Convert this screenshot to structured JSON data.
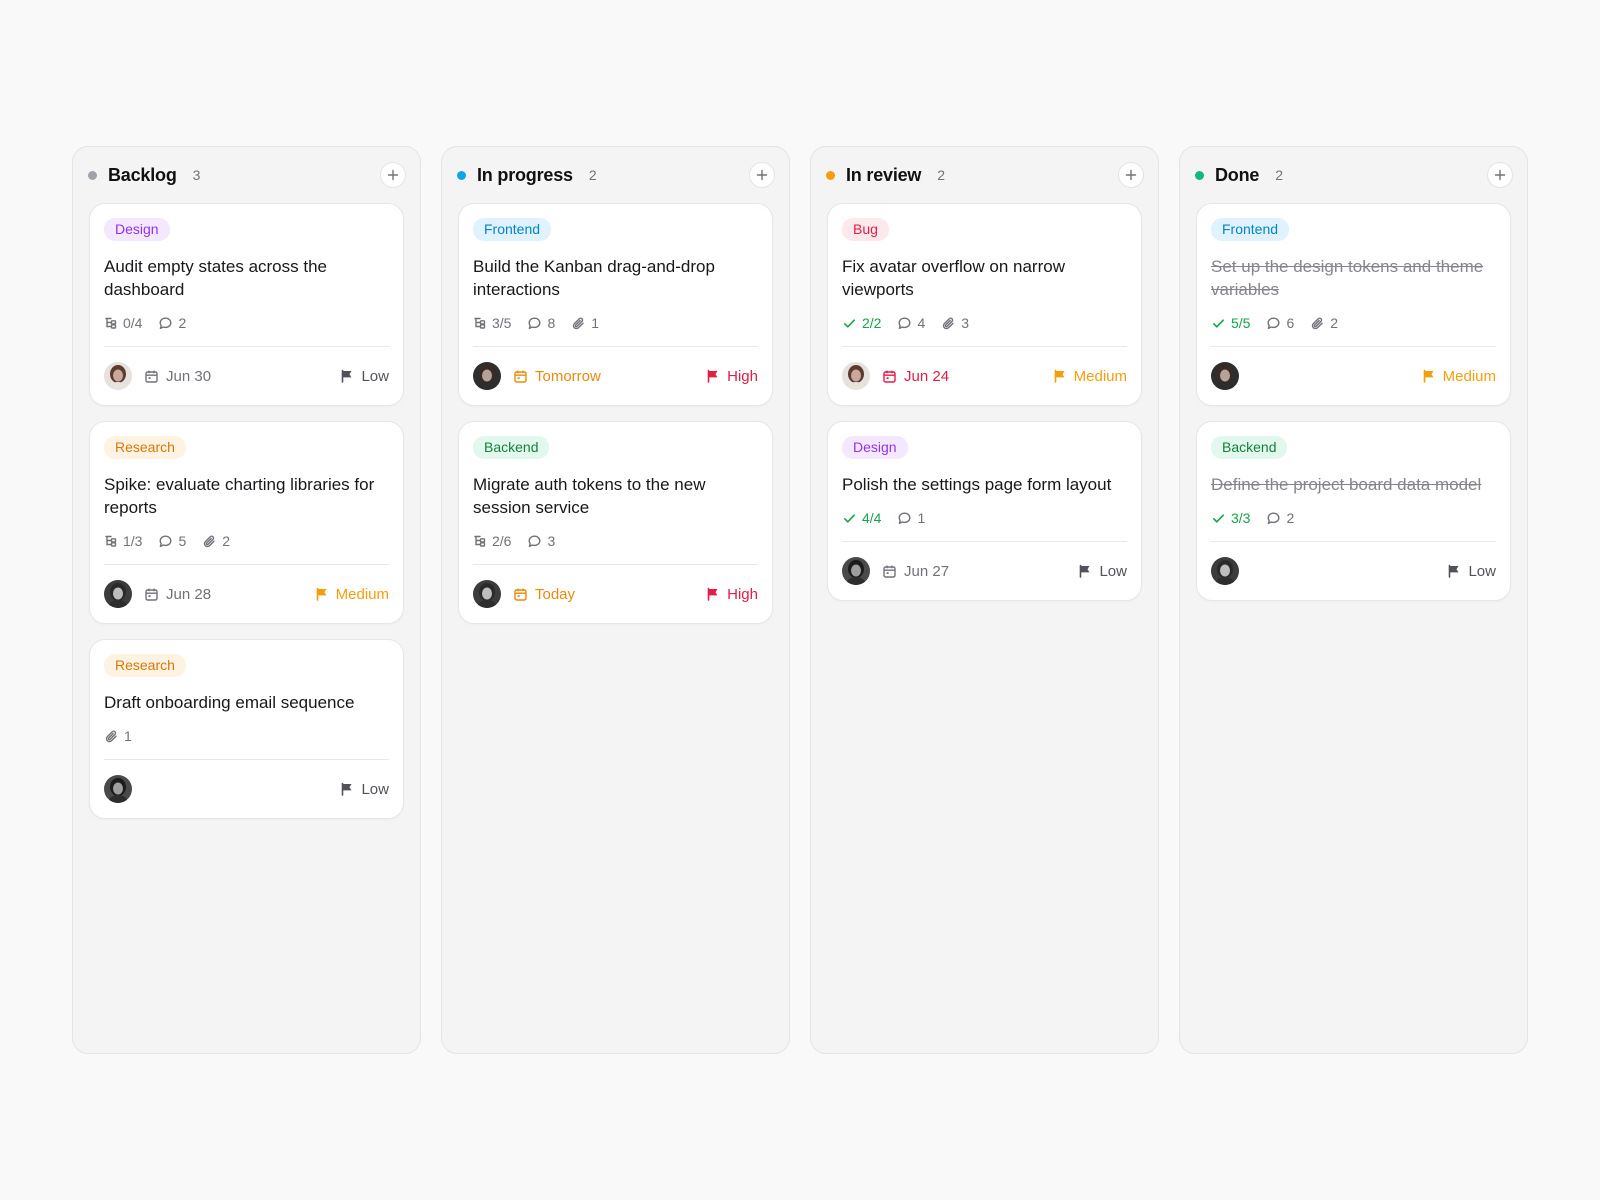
{
  "colors": {
    "backlog": "#a1a1aa",
    "in_progress": "#0ea5e9",
    "in_review": "#f59e0b",
    "done": "#10b981",
    "priority_low": "#52525b",
    "priority_medium": "#f59e0b",
    "priority_high": "#e11d48",
    "date_default": "#71717a",
    "date_soon": "#ea8a0c",
    "date_overdue": "#e11d48",
    "check_done": "#16a34a"
  },
  "tags": {
    "Design": {
      "bg": "#f3e8ff",
      "fg": "#9333ea"
    },
    "Research": {
      "bg": "#fef3e2",
      "fg": "#d97706"
    },
    "Frontend": {
      "bg": "#e0f2fe",
      "fg": "#0284c7"
    },
    "Backend": {
      "bg": "#e3f8ec",
      "fg": "#15803d"
    },
    "Bug": {
      "bg": "#fde8ec",
      "fg": "#e11d48"
    }
  },
  "columns": [
    {
      "id": "backlog",
      "title": "Backlog",
      "count": "3",
      "dot_color": "#a1a1aa",
      "cards": [
        {
          "tag": "Design",
          "title": "Audit empty states across the dashboard",
          "done": false,
          "meta": [
            {
              "icon": "subtasks",
              "text": "0/4"
            },
            {
              "icon": "comment",
              "text": "2"
            }
          ],
          "avatar": "a",
          "due": "Jun 30",
          "due_tone": "default",
          "priority": "Low",
          "priority_tone": "low"
        },
        {
          "tag": "Research",
          "title": "Spike: evaluate charting libraries for reports",
          "done": false,
          "meta": [
            {
              "icon": "subtasks",
              "text": "1/3"
            },
            {
              "icon": "comment",
              "text": "5"
            },
            {
              "icon": "attachment",
              "text": "2"
            }
          ],
          "avatar": "b",
          "due": "Jun 28",
          "due_tone": "default",
          "priority": "Medium",
          "priority_tone": "medium"
        },
        {
          "tag": "Research",
          "title": "Draft onboarding email sequence",
          "done": false,
          "meta": [
            {
              "icon": "attachment",
              "text": "1"
            }
          ],
          "avatar": "c",
          "due": "",
          "due_tone": "default",
          "priority": "Low",
          "priority_tone": "low"
        }
      ]
    },
    {
      "id": "in_progress",
      "title": "In progress",
      "count": "2",
      "dot_color": "#0ea5e9",
      "cards": [
        {
          "tag": "Frontend",
          "title": "Build the Kanban drag-and-drop interactions",
          "done": false,
          "meta": [
            {
              "icon": "subtasks",
              "text": "3/5"
            },
            {
              "icon": "comment",
              "text": "8"
            },
            {
              "icon": "attachment",
              "text": "1"
            }
          ],
          "avatar": "d",
          "due": "Tomorrow",
          "due_tone": "soon",
          "priority": "High",
          "priority_tone": "high"
        },
        {
          "tag": "Backend",
          "title": "Migrate auth tokens to the new session service",
          "done": false,
          "meta": [
            {
              "icon": "subtasks",
              "text": "2/6"
            },
            {
              "icon": "comment",
              "text": "3"
            }
          ],
          "avatar": "b",
          "due": "Today",
          "due_tone": "soon",
          "priority": "High",
          "priority_tone": "high"
        }
      ]
    },
    {
      "id": "in_review",
      "title": "In review",
      "count": "2",
      "dot_color": "#f59e0b",
      "cards": [
        {
          "tag": "Bug",
          "title": "Fix avatar overflow on narrow viewports",
          "done": false,
          "meta": [
            {
              "icon": "check",
              "text": "2/2"
            },
            {
              "icon": "comment",
              "text": "4"
            },
            {
              "icon": "attachment",
              "text": "3"
            }
          ],
          "avatar": "a",
          "due": "Jun 24",
          "due_tone": "overdue",
          "priority": "Medium",
          "priority_tone": "medium"
        },
        {
          "tag": "Design",
          "title": "Polish the settings page form layout",
          "done": false,
          "meta": [
            {
              "icon": "check",
              "text": "4/4"
            },
            {
              "icon": "comment",
              "text": "1"
            }
          ],
          "avatar": "c",
          "due": "Jun 27",
          "due_tone": "default",
          "priority": "Low",
          "priority_tone": "low"
        }
      ]
    },
    {
      "id": "done",
      "title": "Done",
      "count": "2",
      "dot_color": "#10b981",
      "cards": [
        {
          "tag": "Frontend",
          "title": "Set up the design tokens and theme variables",
          "done": true,
          "meta": [
            {
              "icon": "check",
              "text": "5/5"
            },
            {
              "icon": "comment",
              "text": "6"
            },
            {
              "icon": "attachment",
              "text": "2"
            }
          ],
          "avatar": "d",
          "due": "",
          "due_tone": "default",
          "priority": "Medium",
          "priority_tone": "medium"
        },
        {
          "tag": "Backend",
          "title": "Define the project board data model",
          "done": true,
          "meta": [
            {
              "icon": "check",
              "text": "3/3"
            },
            {
              "icon": "comment",
              "text": "2"
            }
          ],
          "avatar": "b",
          "due": "",
          "due_tone": "default",
          "priority": "Low",
          "priority_tone": "low"
        }
      ]
    }
  ]
}
